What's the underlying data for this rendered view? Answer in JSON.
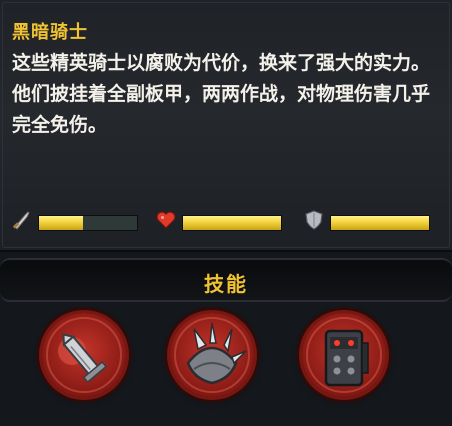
{
  "unit": {
    "name": "黑暗骑士",
    "description": "这些精英骑士以腐败为代价，换来了强大的实力。他们披挂着全副板甲，两两作战，对物理伤害几乎完全免伤。"
  },
  "stats": [
    {
      "name": "attack",
      "icon": "sword-icon",
      "value": 0.45
    },
    {
      "name": "health",
      "icon": "heart-icon",
      "value": 1.0
    },
    {
      "name": "armor",
      "icon": "shield-icon",
      "value": 1.0
    }
  ],
  "skills_section": {
    "title": "技能",
    "skills": [
      {
        "icon": "broken-sword-icon"
      },
      {
        "icon": "spiked-pauldron-icon"
      },
      {
        "icon": "armored-helmet-icon"
      }
    ]
  },
  "colors": {
    "title": "#f1c232",
    "text": "#f4f1ea",
    "bar_fill": "#f6d743",
    "skill_red": "#c3342a"
  }
}
